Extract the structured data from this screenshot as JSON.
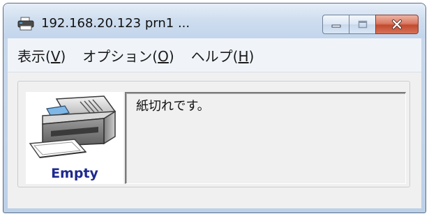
{
  "window": {
    "title": "192.168.20.123 prn1 ...",
    "buttons": {
      "minimize": "minimize",
      "maximize": "maximize",
      "close": "close"
    }
  },
  "menu": {
    "items": [
      {
        "text": "表示(",
        "mnemonic": "V",
        "suffix": ")"
      },
      {
        "text": "オプション(",
        "mnemonic": "O",
        "suffix": ")"
      },
      {
        "text": "ヘルプ(",
        "mnemonic": "H",
        "suffix": ")"
      }
    ]
  },
  "status": {
    "printer_state": "Empty",
    "message": "紙切れです。"
  },
  "icons": {
    "title": "printer-icon",
    "status": "printer-empty-icon"
  },
  "colors": {
    "empty_label": "#1e2a8f",
    "close_button": "#c24a2e"
  }
}
